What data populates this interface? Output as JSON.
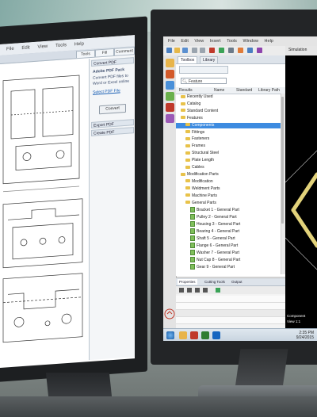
{
  "left_app": {
    "menu": [
      "File",
      "Edit",
      "View",
      "Tools",
      "Help"
    ],
    "tabs": [
      "Tools",
      "Fill",
      "Comment"
    ],
    "panel": {
      "section1": "Convert PDF",
      "text1": "Adobe PDF Pack",
      "text2": "Convert PDF files to Word or Excel online",
      "link": "Select PDF File",
      "button": "Convert",
      "section2": "Export PDF",
      "section3": "Create PDF"
    }
  },
  "right_app": {
    "menu": [
      "File",
      "Edit",
      "View",
      "Insert",
      "Tools",
      "Window",
      "Help"
    ],
    "pane_tabs": [
      "Toolbox",
      "Library"
    ],
    "search_placeholder": "Feature",
    "columns": [
      "Results",
      "Name",
      "Standard",
      "Library Path"
    ],
    "tree": [
      {
        "label": "Recently Used",
        "indent": 1,
        "kind": "folder"
      },
      {
        "label": "Catalog",
        "indent": 1,
        "kind": "folder"
      },
      {
        "label": "Standard Content",
        "indent": 1,
        "kind": "folder"
      },
      {
        "label": "Features",
        "indent": 1,
        "kind": "folder"
      },
      {
        "label": "Components",
        "indent": 2,
        "kind": "folder",
        "selected": true
      },
      {
        "label": "Fittings",
        "indent": 2,
        "kind": "folder"
      },
      {
        "label": "Fasteners",
        "indent": 2,
        "kind": "folder"
      },
      {
        "label": "Frames",
        "indent": 2,
        "kind": "folder"
      },
      {
        "label": "Structural Steel",
        "indent": 2,
        "kind": "folder"
      },
      {
        "label": "Plate Length",
        "indent": 2,
        "kind": "folder"
      },
      {
        "label": "Cables",
        "indent": 2,
        "kind": "folder"
      },
      {
        "label": "Modification Parts",
        "indent": 1,
        "kind": "folder"
      },
      {
        "label": "Modification",
        "indent": 2,
        "kind": "folder"
      },
      {
        "label": "Weldment Parts",
        "indent": 2,
        "kind": "folder"
      },
      {
        "label": "Machine Parts",
        "indent": 2,
        "kind": "folder"
      },
      {
        "label": "General Parts",
        "indent": 2,
        "kind": "folder"
      },
      {
        "label": "Bracket 1 - General Part",
        "indent": 3,
        "kind": "doc"
      },
      {
        "label": "Pulley 2 - General Part",
        "indent": 3,
        "kind": "doc"
      },
      {
        "label": "Housing 3 - General Part",
        "indent": 3,
        "kind": "doc"
      },
      {
        "label": "Bearing 4 - General Part",
        "indent": 3,
        "kind": "doc"
      },
      {
        "label": "Shaft 5 - General Part",
        "indent": 3,
        "kind": "doc"
      },
      {
        "label": "Flange 6 - General Part",
        "indent": 3,
        "kind": "doc"
      },
      {
        "label": "Washer 7 - General Part",
        "indent": 3,
        "kind": "doc"
      },
      {
        "label": "Nut Cap 8 - General Part",
        "indent": 3,
        "kind": "doc"
      },
      {
        "label": "Gear 9 - General Part",
        "indent": 3,
        "kind": "doc"
      }
    ],
    "bottom_tabs": [
      "Properties",
      "Cutting Tools",
      "Output"
    ],
    "viewport_title": "Simulation",
    "viewport_info": [
      "Component",
      "View 1:1"
    ],
    "clock": [
      "2:35 PM",
      "9/24/2015"
    ]
  },
  "colors": {
    "selection": "#3d8be0",
    "folder": "#e8c24a",
    "part_tube": "#e2d27a"
  }
}
